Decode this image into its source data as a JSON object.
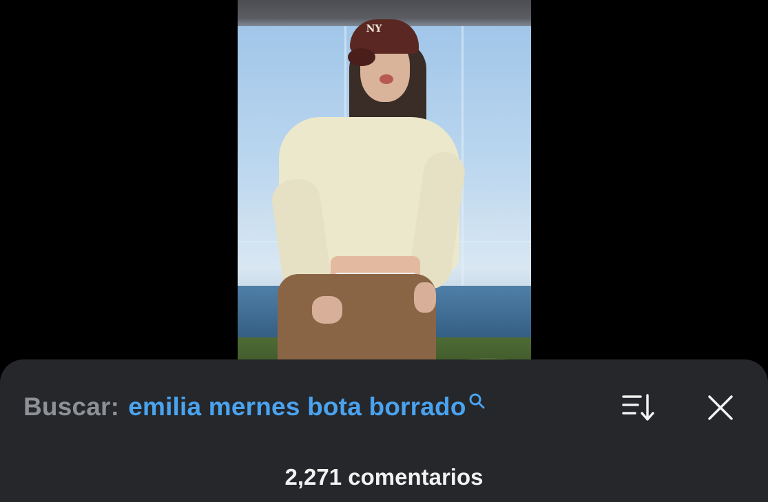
{
  "media": {
    "cap_logo_text": "NY"
  },
  "comments_sheet": {
    "search_label": "Buscar:",
    "search_query": "emilia mernes bota borrado",
    "comment_count_text": "2,271 comentarios",
    "icons": {
      "search": "search-icon",
      "sort": "sort-icon",
      "close": "close-icon"
    },
    "colors": {
      "sheet_background": "#25272b",
      "label": "#8e9196",
      "query_accent": "#4aa3ef",
      "text": "#f2f2f2"
    }
  }
}
